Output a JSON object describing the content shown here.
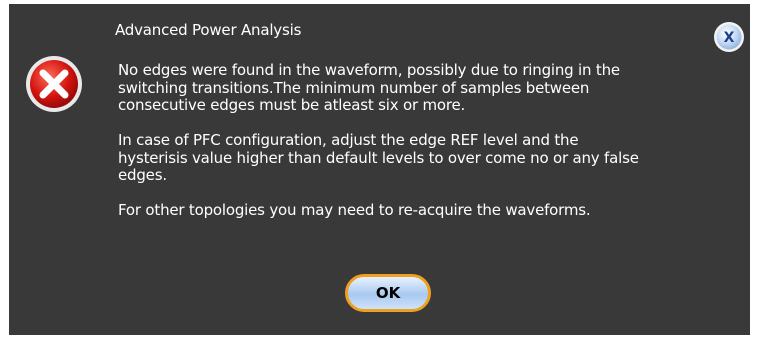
{
  "dialog": {
    "title": "Advanced Power Analysis",
    "messages": [
      " No edges were found in the waveform, possibly due to ringing in the\nswitching transitions.The minimum  number  of samples between\nconsecutive edges must be atleast six or more.",
      " In case of PFC configuration, adjust the edge REF level and the\nhysterisis value higher than default levels to over come no or any false\nedges.",
      " For other topologies you may need to re-acquire the  waveforms."
    ],
    "ok_label": "OK",
    "close_glyph": "X",
    "icons": {
      "error": "error-icon",
      "close": "close-icon"
    }
  }
}
